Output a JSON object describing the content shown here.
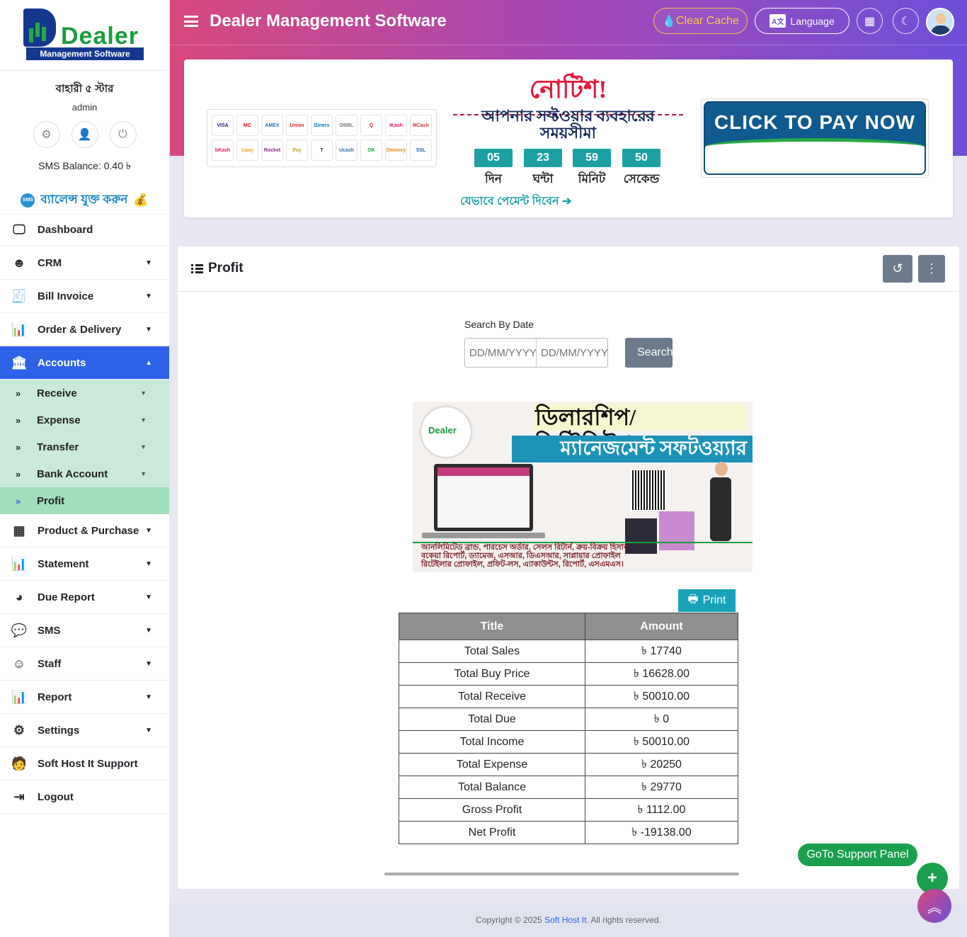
{
  "brand": {
    "logo_word": "Dealer",
    "logo_sub": "Management Software"
  },
  "profile": {
    "shop_name": "বাহারী ৫ স্টার",
    "role": "admin",
    "sms_balance": "SMS Balance: 0.40 ৳",
    "add_balance": "ব্যালেন্স যুক্ত করুন",
    "sms_badge": "SMS"
  },
  "sidebar": {
    "items": [
      {
        "label": "Dashboard",
        "icon": "monitor-icon"
      },
      {
        "label": "CRM",
        "icon": "crm-icon"
      },
      {
        "label": "Bill Invoice",
        "icon": "invoice-icon"
      },
      {
        "label": "Order & Delivery",
        "icon": "bar-chart-icon"
      },
      {
        "label": "Accounts",
        "icon": "bank-icon"
      },
      {
        "label": "Product & Purchase",
        "icon": "boxes-icon"
      },
      {
        "label": "Statement",
        "icon": "bar-chart-icon"
      },
      {
        "label": "Due Report",
        "icon": "pie-chart-icon"
      },
      {
        "label": "SMS",
        "icon": "chat-icon"
      },
      {
        "label": "Staff",
        "icon": "staff-icon"
      },
      {
        "label": "Report",
        "icon": "bar-chart-icon"
      },
      {
        "label": "Settings",
        "icon": "gear-icon"
      },
      {
        "label": "Soft Host It Support",
        "icon": "support-icon"
      },
      {
        "label": "Logout",
        "icon": "logout-icon"
      }
    ],
    "accounts_sub": [
      "Receive",
      "Expense",
      "Transfer",
      "Bank Account",
      "Profit"
    ]
  },
  "header": {
    "title": "Dealer Management Software",
    "clear_cache": "Clear Cache",
    "language": "Language"
  },
  "notice": {
    "title": "নোটিশ!",
    "subtitle": "আপনার সফ্টওয়ার ব্যবহারের সময়সীমা",
    "countdown": [
      {
        "value": "05",
        "label": "দিন"
      },
      {
        "value": "23",
        "label": "ঘন্টা"
      },
      {
        "value": "59",
        "label": "মিনিট"
      },
      {
        "value": "50",
        "label": "সেকেন্ড"
      }
    ],
    "how_to_pay": "যেভাবে পেমেন্ট দিবেন ➔",
    "pay_now": "CLICK TO PAY NOW",
    "cards": [
      "VISA",
      "MC",
      "AMEX",
      "Union",
      "Diners",
      "DBBL",
      "Q",
      "iKash",
      "MCash",
      "bKash",
      "Upay",
      "Rocket",
      "Pay",
      "T",
      "Ucash",
      "OK",
      "Dmoney",
      "SSL"
    ]
  },
  "main": {
    "title": "Profit",
    "search_label": "Search By Date",
    "date_from_placeholder": "DD/MM/YYYY",
    "date_to_placeholder": "DD/MM/YYYY",
    "search_button": "Search",
    "print_button": "Print",
    "banner": {
      "logo": "Dealer",
      "line1": "ডিলারশিপ/ডিস্ট্রিবিউশন",
      "line2": "ম্যানেজমেন্ট সফটওয়্যার",
      "footer": "আনলিমিটেড ব্রান্ড, পারচেস অর্ডার, সেলস রিটার্ন, ক্রয়-বিক্রয় হিসাব বকেয়া রিপোর্ট, ড্যামেজ, এসআর, ডিএসআর, সাপ্লায়ার প্রোফাইল রিটেইলার প্রোফাইল, প্রফিট-লস, এ্যাকাউন্টস, রিপোর্ট, এসএমএস।"
    },
    "table": {
      "headers": [
        "Title",
        "Amount"
      ],
      "rows": [
        [
          "Total Sales",
          "৳ 17740"
        ],
        [
          "Total Buy Price",
          "৳ 16628.00"
        ],
        [
          "Total Receive",
          "৳ 50010.00"
        ],
        [
          "Total Due",
          "৳ 0"
        ],
        [
          "Total Income",
          "৳ 50010.00"
        ],
        [
          "Total Expense",
          "৳ 20250"
        ],
        [
          "Total Balance",
          "৳ 29770"
        ],
        [
          "Gross Profit",
          "৳ 1112.00"
        ],
        [
          "Net Profit",
          "৳ -19138.00"
        ]
      ]
    }
  },
  "footer": {
    "prefix": "Copyright © 2025 ",
    "company": "Soft Host It",
    "suffix": ". All rights reserved."
  },
  "floating": {
    "support_panel": "GoTo Support Panel"
  }
}
